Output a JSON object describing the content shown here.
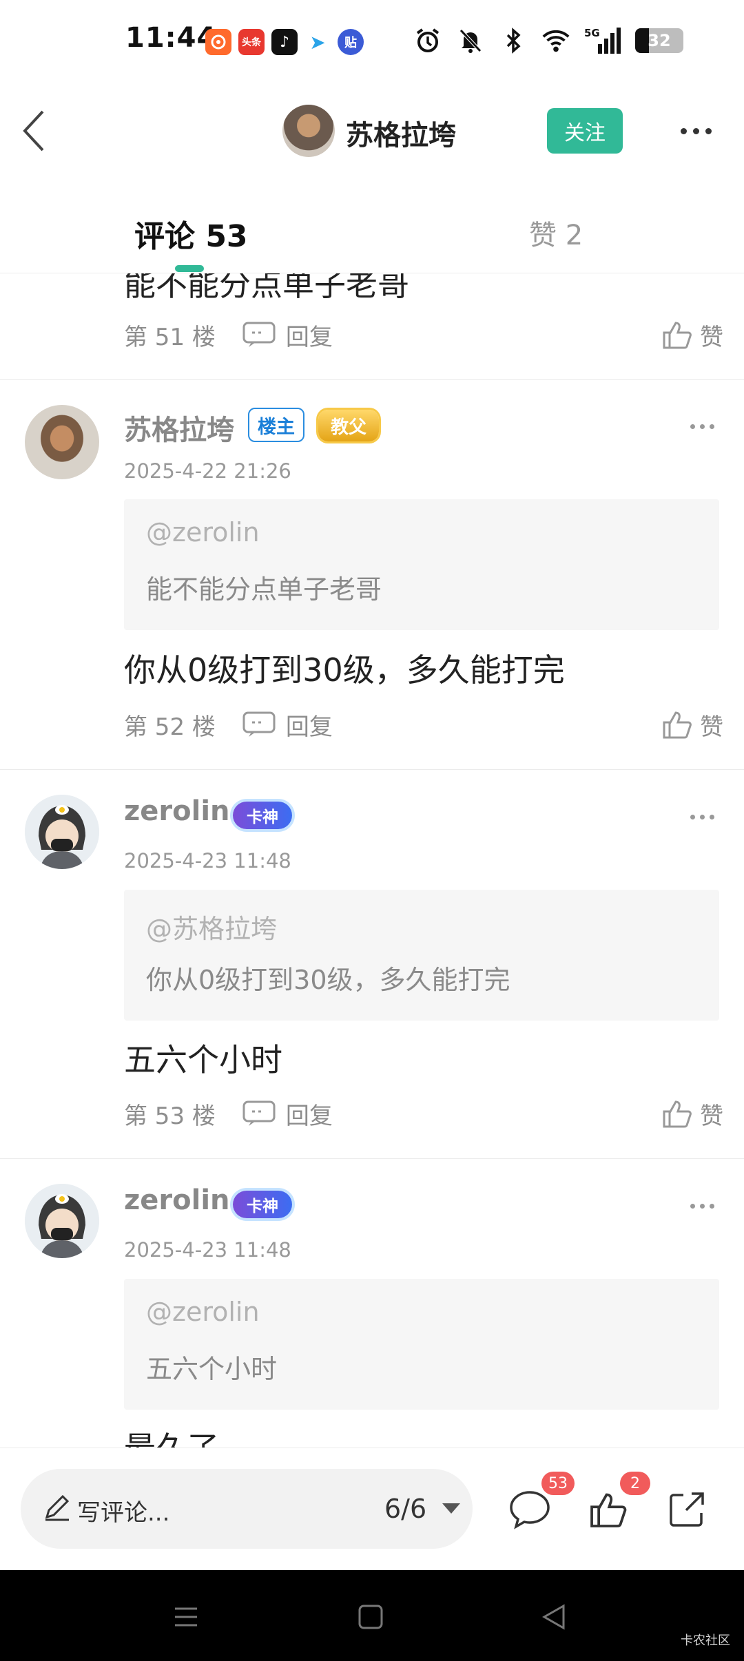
{
  "status_bar": {
    "time": "11:44",
    "notifications": [
      {
        "icon": "app-orange-icon",
        "label": "",
        "color": "#ff6a2c"
      },
      {
        "icon": "toutiao-icon",
        "label": "头条",
        "color": "#e8382f"
      },
      {
        "icon": "tiktok-icon",
        "label": "♪",
        "color": "#111111"
      },
      {
        "icon": "telegram-icon",
        "label": "➤",
        "color": "#2aa3e8"
      },
      {
        "icon": "tieba-icon",
        "label": "贴",
        "color": "#3b5bd6"
      }
    ],
    "network": "5G",
    "battery": "32"
  },
  "header": {
    "username": "苏格拉垮",
    "follow_label": "关注"
  },
  "tabs": {
    "comments": "评论 53",
    "likes": "赞 2"
  },
  "feed": {
    "truncated_text": "能不能分点单子老哥",
    "items": [
      {
        "floor": "第 51 楼",
        "reply_label": "回复",
        "like_label": "赞"
      },
      {
        "username": "苏格拉垮",
        "op_badge": "楼主",
        "rank_badge": "教父",
        "datetime": "2025-4-22 21:26",
        "quote_user": "@zerolin",
        "quote_text": "能不能分点单子老哥",
        "content": "你从0级打到30级，多久能打完",
        "floor": "第 52 楼",
        "reply_label": "回复",
        "like_label": "赞"
      },
      {
        "username": "zerolin",
        "rank_badge": "卡神",
        "datetime": "2025-4-23 11:48",
        "quote_user": "@苏格拉垮",
        "quote_text": "你从0级打到30级，多久能打完",
        "content": "五六个小时",
        "floor": "第 53 楼",
        "reply_label": "回复",
        "like_label": "赞"
      },
      {
        "username": "zerolin",
        "rank_badge": "卡神",
        "datetime": "2025-4-23 11:48",
        "quote_user": "@zerolin",
        "quote_text": "五六个小时",
        "content": "最久了"
      }
    ]
  },
  "bottom_bar": {
    "compose_placeholder": "写评论...",
    "page_indicator": "6/6",
    "comment_count": "53",
    "like_count": "2"
  },
  "watermark": "卡农社区",
  "colors": {
    "accent": "#31b997",
    "badge_red": "#f15b5b"
  }
}
